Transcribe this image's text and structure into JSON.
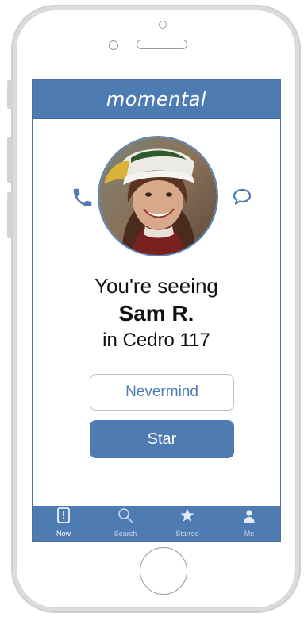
{
  "app": {
    "title": "momental"
  },
  "icons": {
    "call": "phone-icon",
    "message": "chat-bubble-icon"
  },
  "profile": {
    "line1": "You're seeing",
    "name": "Sam R.",
    "location_line": "in Cedro 117"
  },
  "actions": {
    "cancel_label": "Nevermind",
    "primary_label": "Star"
  },
  "tabs": [
    {
      "label": "Now",
      "icon": "now-icon",
      "active": true
    },
    {
      "label": "Search",
      "icon": "search-icon",
      "active": false
    },
    {
      "label": "Starred",
      "icon": "star-icon",
      "active": false
    },
    {
      "label": "Me",
      "icon": "person-icon",
      "active": false
    }
  ],
  "colors": {
    "brand": "#4e7cb2",
    "accent_text": "#4e7cb2"
  }
}
